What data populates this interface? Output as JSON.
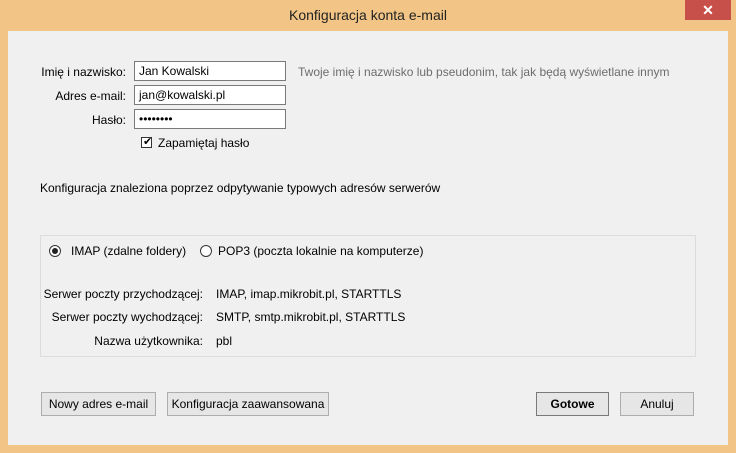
{
  "window": {
    "title": "Konfiguracja konta e-mail",
    "close_glyph": "✕"
  },
  "form": {
    "name_label": "Imię i nazwisko:",
    "name_value": "Jan Kowalski",
    "name_hint": "Twoje imię i nazwisko lub pseudonim, tak jak będą wyświetlane innym",
    "email_label": "Adres e-mail:",
    "email_value": "jan@kowalski.pl",
    "password_label": "Hasło:",
    "password_value": "••••••••",
    "remember_label": "Zapamiętaj hasło",
    "remember_checked": true
  },
  "status_text": "Konfiguracja znaleziona poprzez odpytywanie typowych adresów serwerów",
  "protocol": {
    "imap_label": "IMAP (zdalne foldery)",
    "pop3_label": "POP3 (poczta lokalnie na komputerze)",
    "selected": "imap"
  },
  "servers": {
    "incoming_label": "Serwer poczty przychodzącej:",
    "incoming_value": "IMAP, imap.mikrobit.pl, STARTTLS",
    "outgoing_label": "Serwer poczty wychodzącej:",
    "outgoing_value": "SMTP, smtp.mikrobit.pl, STARTTLS",
    "username_label": "Nazwa użytkownika:",
    "username_value": "pbl"
  },
  "buttons": {
    "new_email": "Nowy adres e-mail",
    "advanced": "Konfiguracja zaawansowana",
    "done": "Gotowe",
    "cancel": "Anuluj"
  },
  "colors": {
    "titlebar": "#f2c586",
    "close_button": "#c7504b",
    "client_bg": "#f0f0f0"
  }
}
